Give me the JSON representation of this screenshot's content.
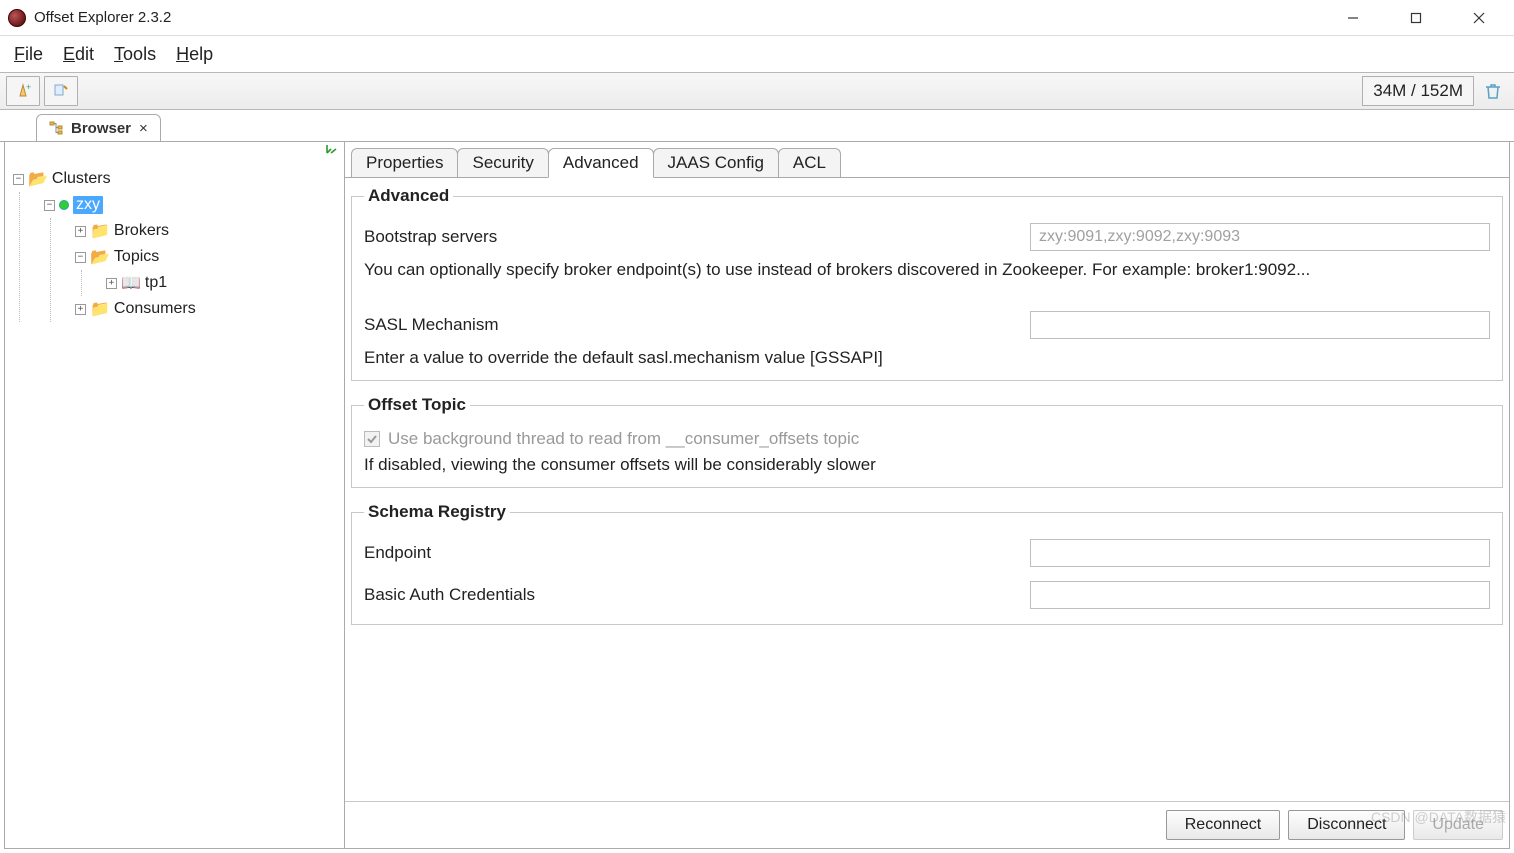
{
  "window": {
    "title": "Offset Explorer  2.3.2"
  },
  "menu": {
    "file": "File",
    "edit": "Edit",
    "tools": "Tools",
    "help": "Help"
  },
  "toolbar": {
    "memory": "34M / 152M"
  },
  "mainTab": {
    "label": "Browser"
  },
  "tree": {
    "root": "Clusters",
    "cluster": "zxy",
    "brokers": "Brokers",
    "topics": "Topics",
    "tp1": "tp1",
    "consumers": "Consumers"
  },
  "subtabs": {
    "properties": "Properties",
    "security": "Security",
    "advanced": "Advanced",
    "jaas": "JAAS Config",
    "acl": "ACL"
  },
  "advanced": {
    "legend": "Advanced",
    "bootstrap_label": "Bootstrap servers",
    "bootstrap_placeholder": "zxy:9091,zxy:9092,zxy:9093",
    "bootstrap_help": "You can optionally specify broker endpoint(s) to use instead of brokers discovered in Zookeeper. For example: broker1:9092...",
    "sasl_label": "SASL Mechanism",
    "sasl_help": "Enter a value to override the default sasl.mechanism value [GSSAPI]"
  },
  "offsetTopic": {
    "legend": "Offset Topic",
    "checkbox_label": "Use background thread to read from __consumer_offsets topic",
    "help": "If disabled, viewing the consumer offsets will be considerably slower"
  },
  "schema": {
    "legend": "Schema Registry",
    "endpoint_label": "Endpoint",
    "basic_auth_label": "Basic Auth Credentials"
  },
  "buttons": {
    "reconnect": "Reconnect",
    "disconnect": "Disconnect",
    "update": "Update"
  },
  "watermark": "CSDN @DATA数据猿"
}
